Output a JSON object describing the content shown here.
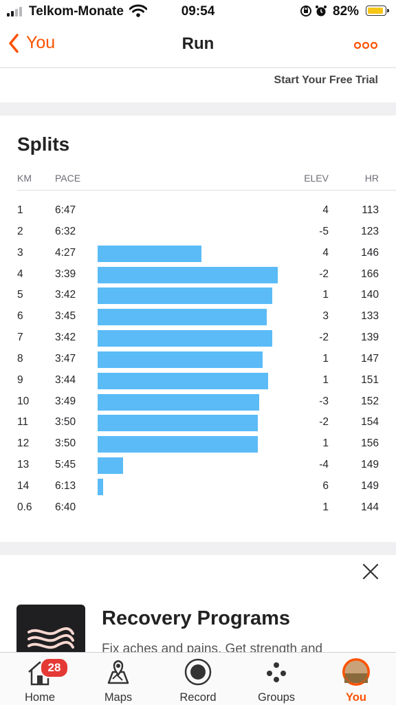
{
  "status_bar": {
    "carrier": "Telkom-Monate",
    "time": "09:54",
    "battery": "82%"
  },
  "nav": {
    "back_label": "You",
    "title": "Run"
  },
  "trial_link": "Start Your Free Trial",
  "splits": {
    "title": "Splits",
    "headers": {
      "km": "KM",
      "pace": "PACE",
      "elev": "ELEV",
      "hr": "HR"
    },
    "rows": [
      {
        "km": "1",
        "pace": "6:47",
        "elev": "4",
        "hr": "113"
      },
      {
        "km": "2",
        "pace": "6:32",
        "elev": "-5",
        "hr": "123"
      },
      {
        "km": "3",
        "pace": "4:27",
        "elev": "4",
        "hr": "146"
      },
      {
        "km": "4",
        "pace": "3:39",
        "elev": "-2",
        "hr": "166"
      },
      {
        "km": "5",
        "pace": "3:42",
        "elev": "1",
        "hr": "140"
      },
      {
        "km": "6",
        "pace": "3:45",
        "elev": "3",
        "hr": "133"
      },
      {
        "km": "7",
        "pace": "3:42",
        "elev": "-2",
        "hr": "139"
      },
      {
        "km": "8",
        "pace": "3:47",
        "elev": "1",
        "hr": "147"
      },
      {
        "km": "9",
        "pace": "3:44",
        "elev": "1",
        "hr": "151"
      },
      {
        "km": "10",
        "pace": "3:49",
        "elev": "-3",
        "hr": "152"
      },
      {
        "km": "11",
        "pace": "3:50",
        "elev": "-2",
        "hr": "154"
      },
      {
        "km": "12",
        "pace": "3:50",
        "elev": "1",
        "hr": "156"
      },
      {
        "km": "13",
        "pace": "5:45",
        "elev": "-4",
        "hr": "149"
      },
      {
        "km": "14",
        "pace": "6:13",
        "elev": "6",
        "hr": "149"
      },
      {
        "km": "0.6",
        "pace": "6:40",
        "elev": "1",
        "hr": "144"
      }
    ],
    "bar_color": "#5abbf6"
  },
  "promo": {
    "title": "Recovery Programs",
    "subtitle": "Fix aches and pains. Get strength and"
  },
  "tabbar": {
    "home_label": "Home",
    "home_badge": "28",
    "maps_label": "Maps",
    "record_label": "Record",
    "groups_label": "Groups",
    "you_label": "You"
  },
  "colors": {
    "accent": "#fc5200",
    "badge": "#e53935"
  }
}
